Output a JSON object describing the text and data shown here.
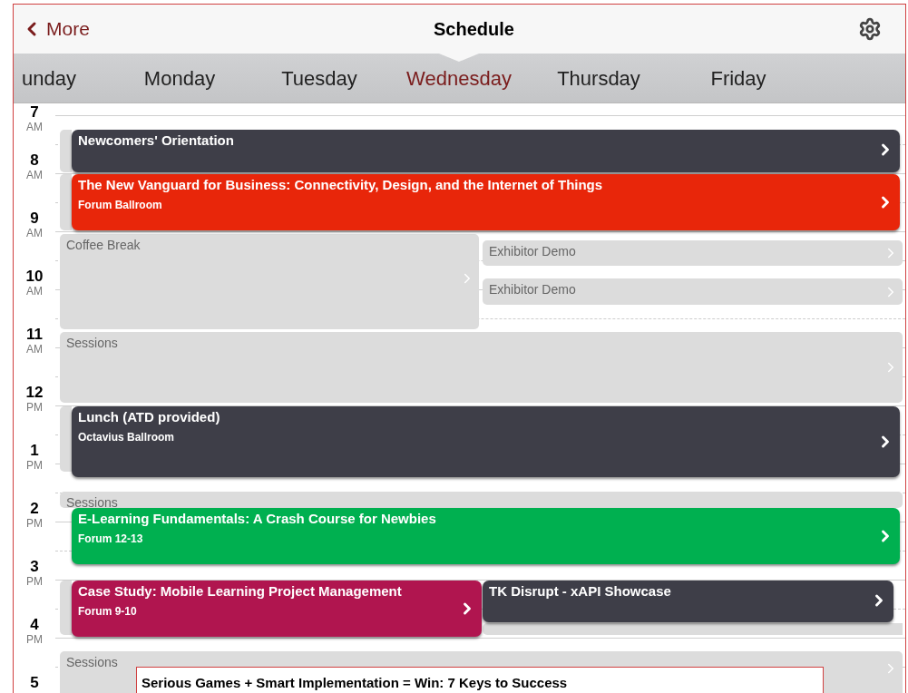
{
  "header": {
    "back": "More",
    "title": "Schedule"
  },
  "days": [
    {
      "label": "unday",
      "selected": false
    },
    {
      "label": "Monday",
      "selected": false
    },
    {
      "label": "Tuesday",
      "selected": false
    },
    {
      "label": "Wednesday",
      "selected": true
    },
    {
      "label": "Thursday",
      "selected": false
    },
    {
      "label": "Friday",
      "selected": false
    }
  ],
  "hours": [
    {
      "hour": "7",
      "period": "AM"
    },
    {
      "hour": "8",
      "period": "AM"
    },
    {
      "hour": "9",
      "period": "AM"
    },
    {
      "hour": "10",
      "period": "AM"
    },
    {
      "hour": "11",
      "period": "AM"
    },
    {
      "hour": "12",
      "period": "PM"
    },
    {
      "hour": "1",
      "period": "PM"
    },
    {
      "hour": "2",
      "period": "PM"
    },
    {
      "hour": "3",
      "period": "PM"
    },
    {
      "hour": "4",
      "period": "PM"
    },
    {
      "hour": "5"
    }
  ],
  "events": [
    {
      "kind": "card",
      "title": "Newcomers' Orientation",
      "color": "#3e3e48"
    },
    {
      "kind": "card",
      "title": "The New Vanguard for Business: Connectivity, Design, and the Internet of Things",
      "location": "Forum Ballroom",
      "color": "#e8260a"
    },
    {
      "kind": "block",
      "title": "Coffee Break"
    },
    {
      "kind": "block",
      "title": "Exhibitor Demo"
    },
    {
      "kind": "block",
      "title": "Exhibitor Demo"
    },
    {
      "kind": "block",
      "title": "Sessions"
    },
    {
      "kind": "card",
      "title": "Lunch (ATD provided)",
      "location": "Octavius Ballroom",
      "color": "#3e3e48"
    },
    {
      "kind": "block",
      "title": "Sessions"
    },
    {
      "kind": "card",
      "title": "E-Learning Fundamentals: A Crash Course for Newbies",
      "location": "Forum 12-13",
      "color": "#00b050"
    },
    {
      "kind": "card",
      "title": "Case Study: Mobile Learning Project Management",
      "location": "Forum 9-10",
      "color": "#b0154f"
    },
    {
      "kind": "card",
      "title": "TK Disrupt - xAPI Showcase",
      "color": "#3e3e48"
    },
    {
      "kind": "block",
      "title": "Sessions"
    }
  ],
  "popup": {
    "title": "Serious Games + Smart Implementation = Win: 7 Keys to Success"
  }
}
